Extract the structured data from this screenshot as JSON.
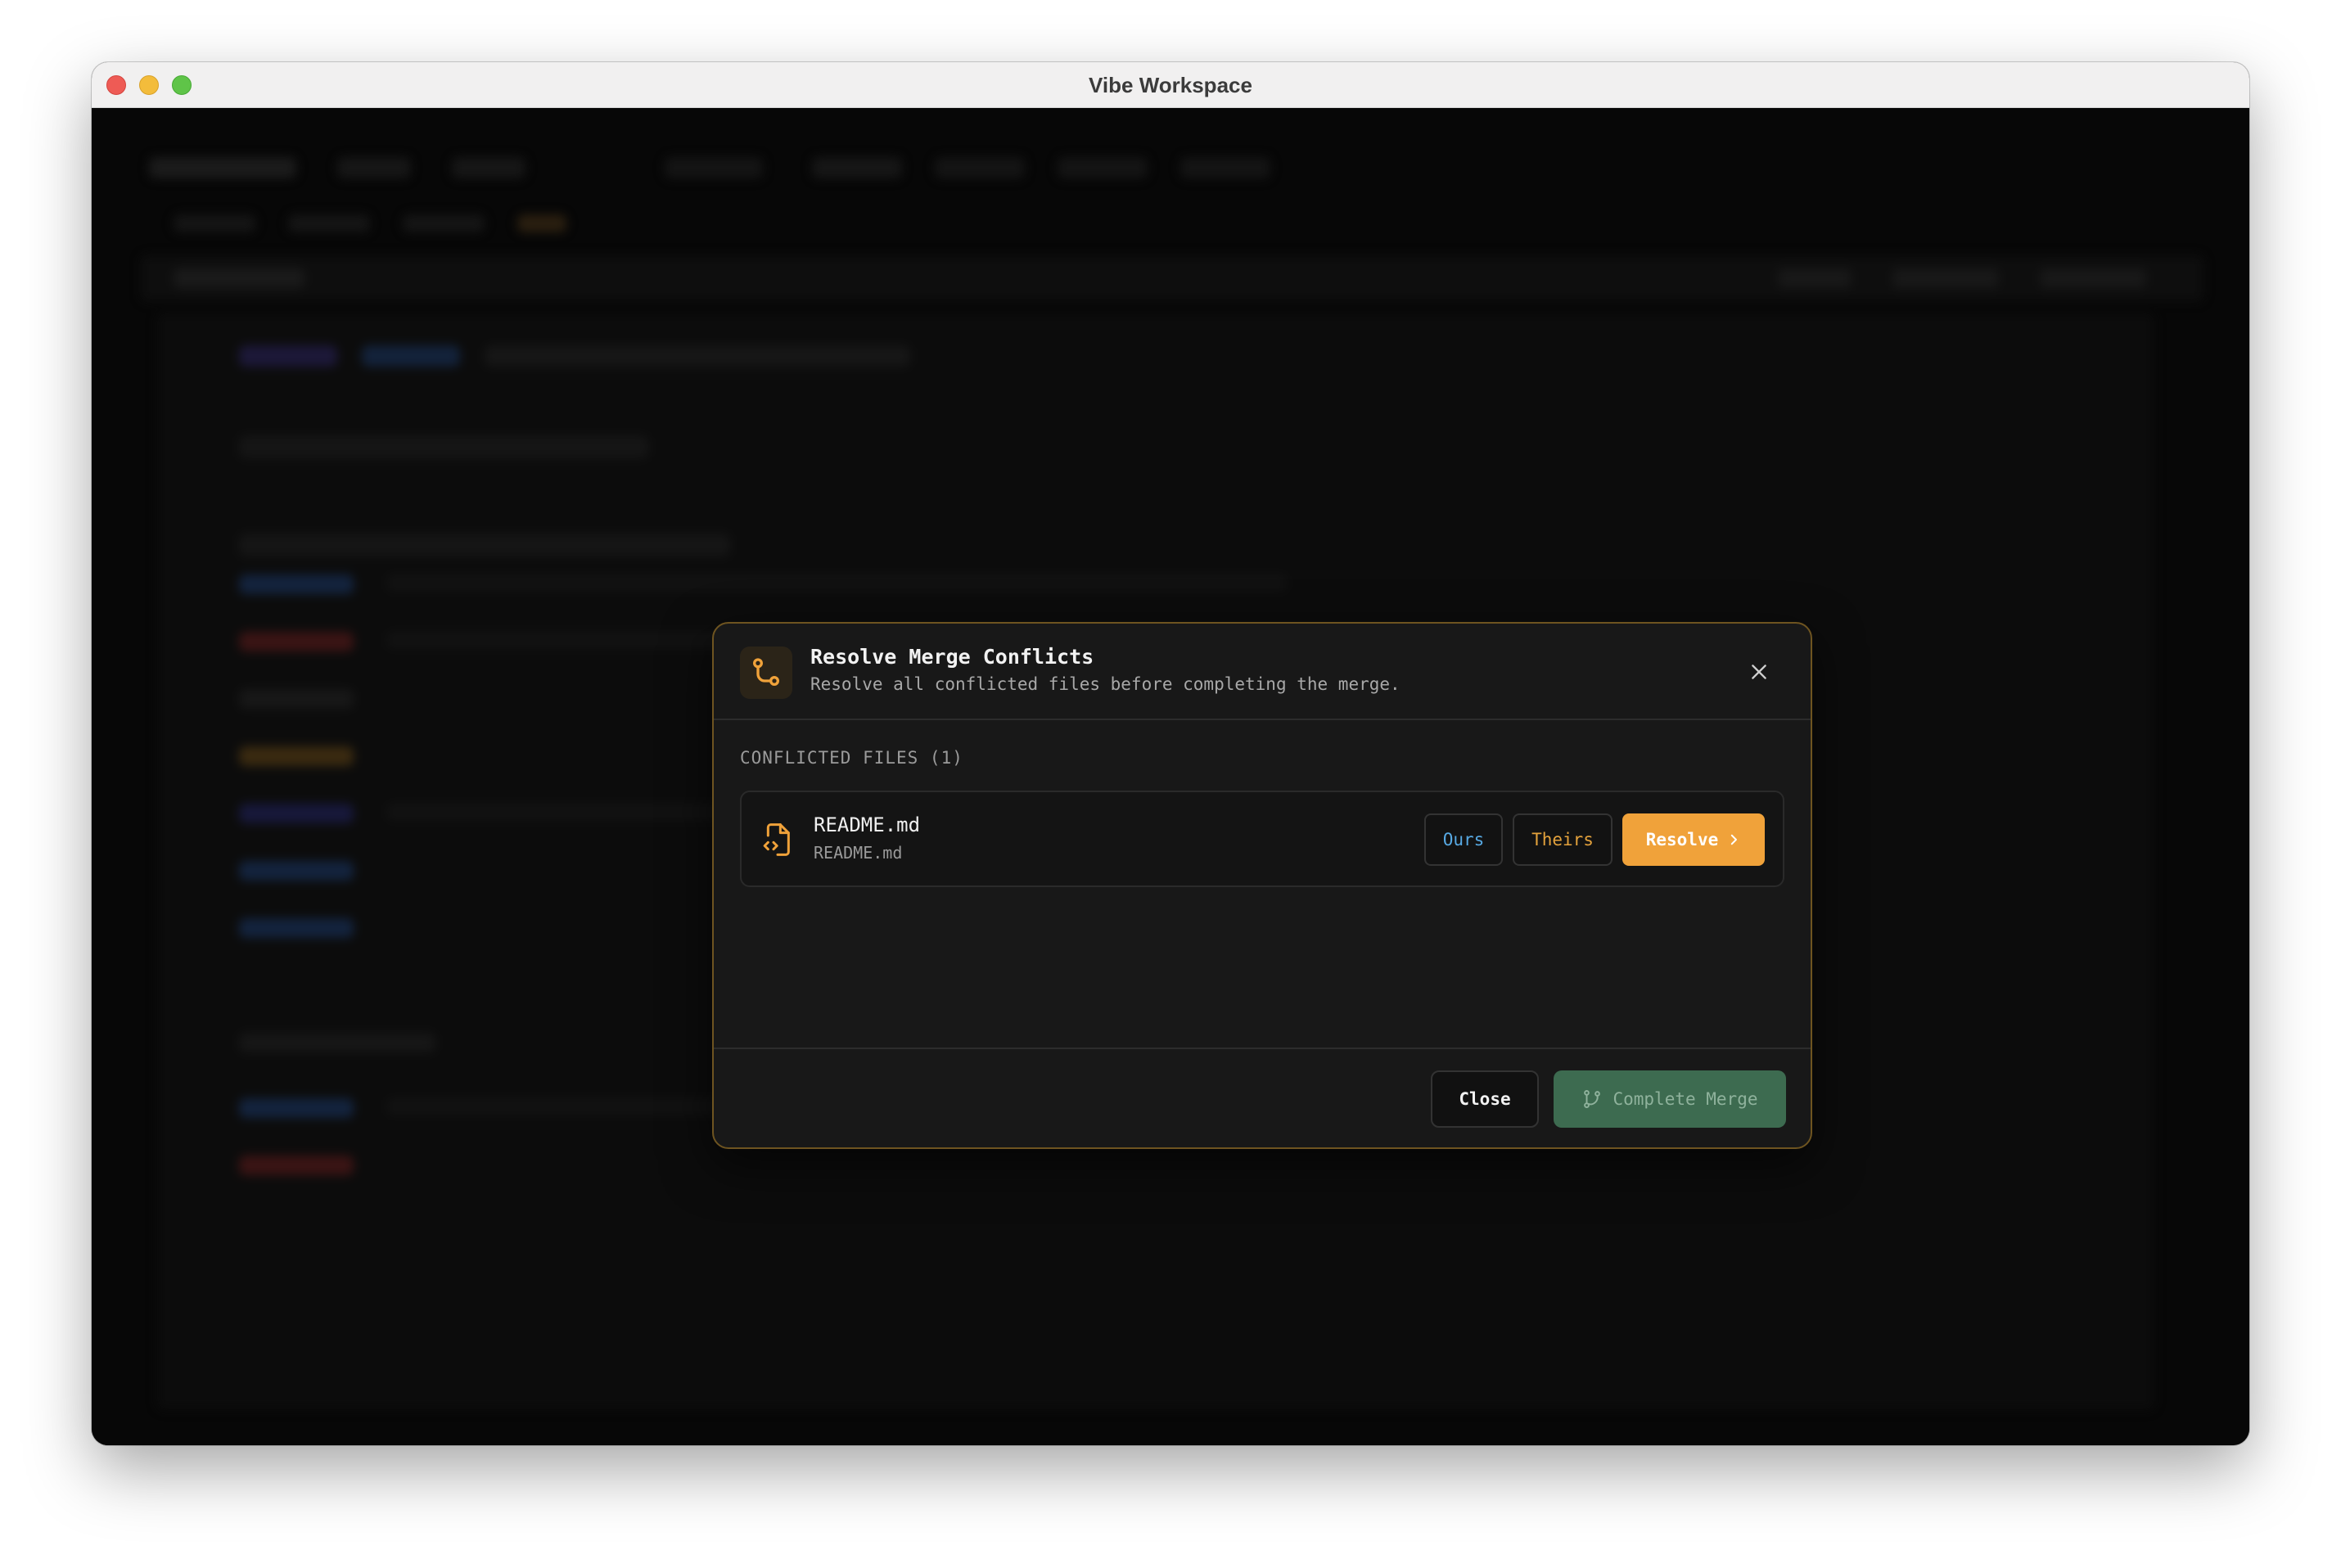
{
  "window": {
    "title": "Vibe Workspace"
  },
  "dialog": {
    "title": "Resolve Merge Conflicts",
    "subtitle": "Resolve all conflicted files before completing the merge.",
    "icon": "git-merge-icon",
    "close_icon": "close-icon",
    "section_label": "CONFLICTED FILES (1)",
    "files": [
      {
        "name": "README.md",
        "path": "README.md",
        "icon": "file-code-icon",
        "ours_label": "Ours",
        "theirs_label": "Theirs",
        "resolve_label": "Resolve"
      }
    ],
    "footer": {
      "close_label": "Close",
      "complete_label": "Complete Merge",
      "complete_icon": "git-branch-icon"
    }
  },
  "colors": {
    "accent": "#f0a23a",
    "ours": "#57a9e3",
    "theirs": "#e4a23c",
    "complete": "#3d6b50",
    "modal_border": "#6e5420"
  }
}
